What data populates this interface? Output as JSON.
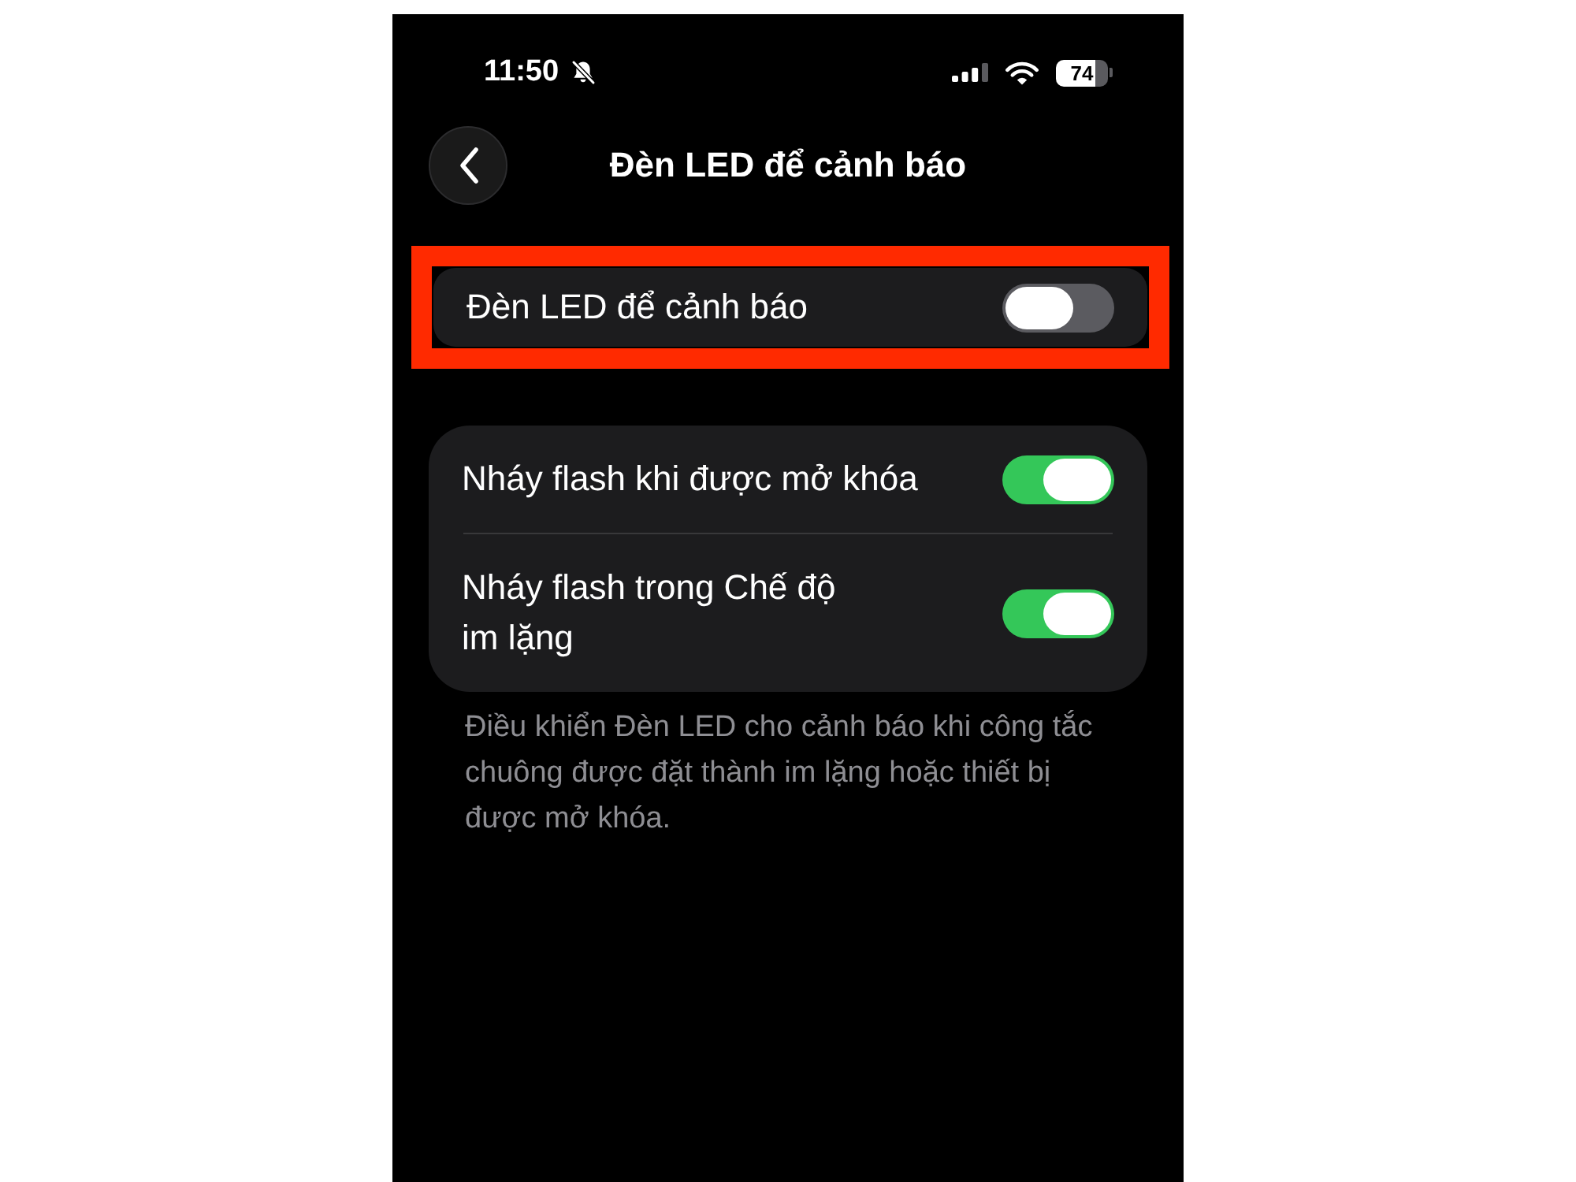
{
  "status_bar": {
    "time": "11:50",
    "battery": "74"
  },
  "nav": {
    "title": "Đèn LED để cảnh báo"
  },
  "sections": [
    {
      "highlighted": true,
      "rows": [
        {
          "label": "Đèn LED để cảnh báo",
          "on": false
        }
      ]
    },
    {
      "highlighted": false,
      "rows": [
        {
          "label": "Nháy flash khi được mở khóa",
          "on": true
        },
        {
          "label": "Nháy flash trong Chế độ\nim lặng",
          "on": true
        }
      ],
      "footer": "Điều khiển Đèn LED cho cảnh báo khi công tắc chuông được đặt thành im lặng hoặc thiết bị được mở khóa."
    }
  ]
}
